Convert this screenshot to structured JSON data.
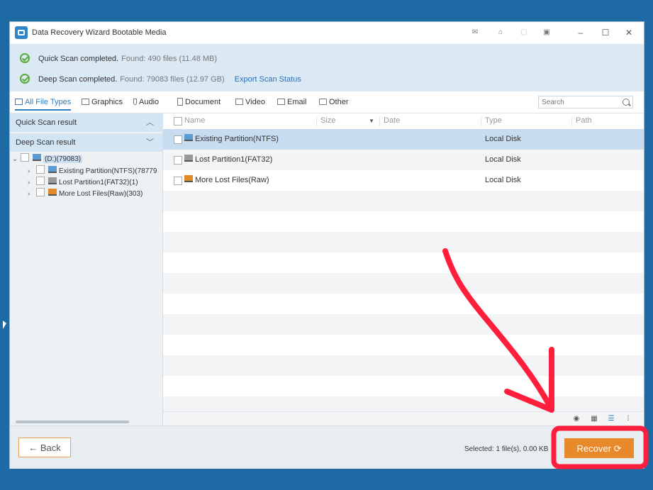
{
  "window": {
    "title": "Data Recovery Wizard Bootable Media",
    "title_buttons": [
      "hint-icon",
      "cart-icon",
      "restore-icon",
      "menu-icon",
      "minimize-icon",
      "maximize-icon",
      "close-icon"
    ]
  },
  "status": {
    "quick": {
      "label": "Quick Scan completed.",
      "found": "Found: 490 files (11.48 MB)"
    },
    "deep": {
      "label": "Deep Scan completed.",
      "found": "Found: 79083 files (12.97 GB)",
      "export_link": "Export Scan Status"
    }
  },
  "filters": {
    "tabs": [
      {
        "label": "All File Types",
        "icon": "monitor-icon",
        "active": true
      },
      {
        "label": "Graphics",
        "icon": "image-icon"
      },
      {
        "label": "Audio",
        "icon": "music-icon"
      },
      {
        "label": "Document",
        "icon": "document-icon"
      },
      {
        "label": "Video",
        "icon": "video-icon"
      },
      {
        "label": "Email",
        "icon": "email-icon"
      },
      {
        "label": "Other",
        "icon": "folder-icon"
      }
    ],
    "search_placeholder": "Search"
  },
  "left_pane": {
    "quick_scan_label": "Quick Scan result",
    "deep_scan_label": "Deep Scan result",
    "tree": {
      "root": "(D:)(79083)",
      "children": [
        "Existing Partition(NTFS)(78779",
        "Lost Partition1(FAT32)(1)",
        "More Lost Files(Raw)(303)"
      ]
    }
  },
  "file_list": {
    "columns": [
      "Name",
      "Size",
      "Date",
      "Type",
      "Path"
    ],
    "rows": [
      {
        "name": "Existing Partition(NTFS)",
        "type": "Local Disk",
        "icon": "partition-icon",
        "selected": true
      },
      {
        "name": "Lost Partition1(FAT32)",
        "type": "Local Disk",
        "icon": "lost-partition-icon",
        "selected": false
      },
      {
        "name": "More Lost Files(Raw)",
        "type": "Local Disk",
        "icon": "raw-files-icon",
        "selected": false
      }
    ]
  },
  "view_icons": [
    "preview-icon",
    "grid-view-icon",
    "list-view-icon",
    "detail-view-icon"
  ],
  "bottom": {
    "back_label": "Back",
    "selected_text": "Selected: 1 file(s), 0.00 KB",
    "recover_label": "Recover"
  },
  "colors": {
    "accent": "#2b7cc8",
    "recover": "#e8892b",
    "annotation": "#ff1f3d",
    "desktop": "#1e6aa5"
  }
}
